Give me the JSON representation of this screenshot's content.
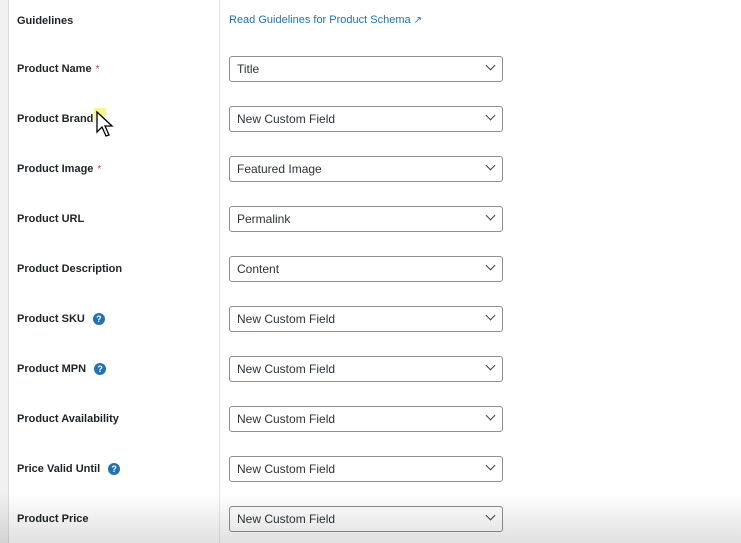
{
  "guidelines": {
    "label": "Guidelines",
    "link_text": "Read Guidelines for Product Schema",
    "link_icon": "external-link-icon"
  },
  "fields": [
    {
      "label": "Product Name",
      "required": "*",
      "value": "Title"
    },
    {
      "label": "Product Brand",
      "value": "New Custom Field"
    },
    {
      "label": "Product Image",
      "required": "*",
      "value": "Featured Image"
    },
    {
      "label": "Product URL",
      "value": "Permalink"
    },
    {
      "label": "Product Description",
      "value": "Content"
    },
    {
      "label": "Product SKU",
      "help": "?",
      "value": "New Custom Field"
    },
    {
      "label": "Product MPN",
      "help": "?",
      "value": "New Custom Field"
    },
    {
      "label": "Product Availability",
      "value": "New Custom Field"
    },
    {
      "label": "Price Valid Until",
      "help": "?",
      "value": "New Custom Field"
    },
    {
      "label": "Product Price",
      "value": "New Custom Field"
    }
  ],
  "colors": {
    "link": "#2271b1",
    "required": "#d63638",
    "help": "#2271b1"
  }
}
